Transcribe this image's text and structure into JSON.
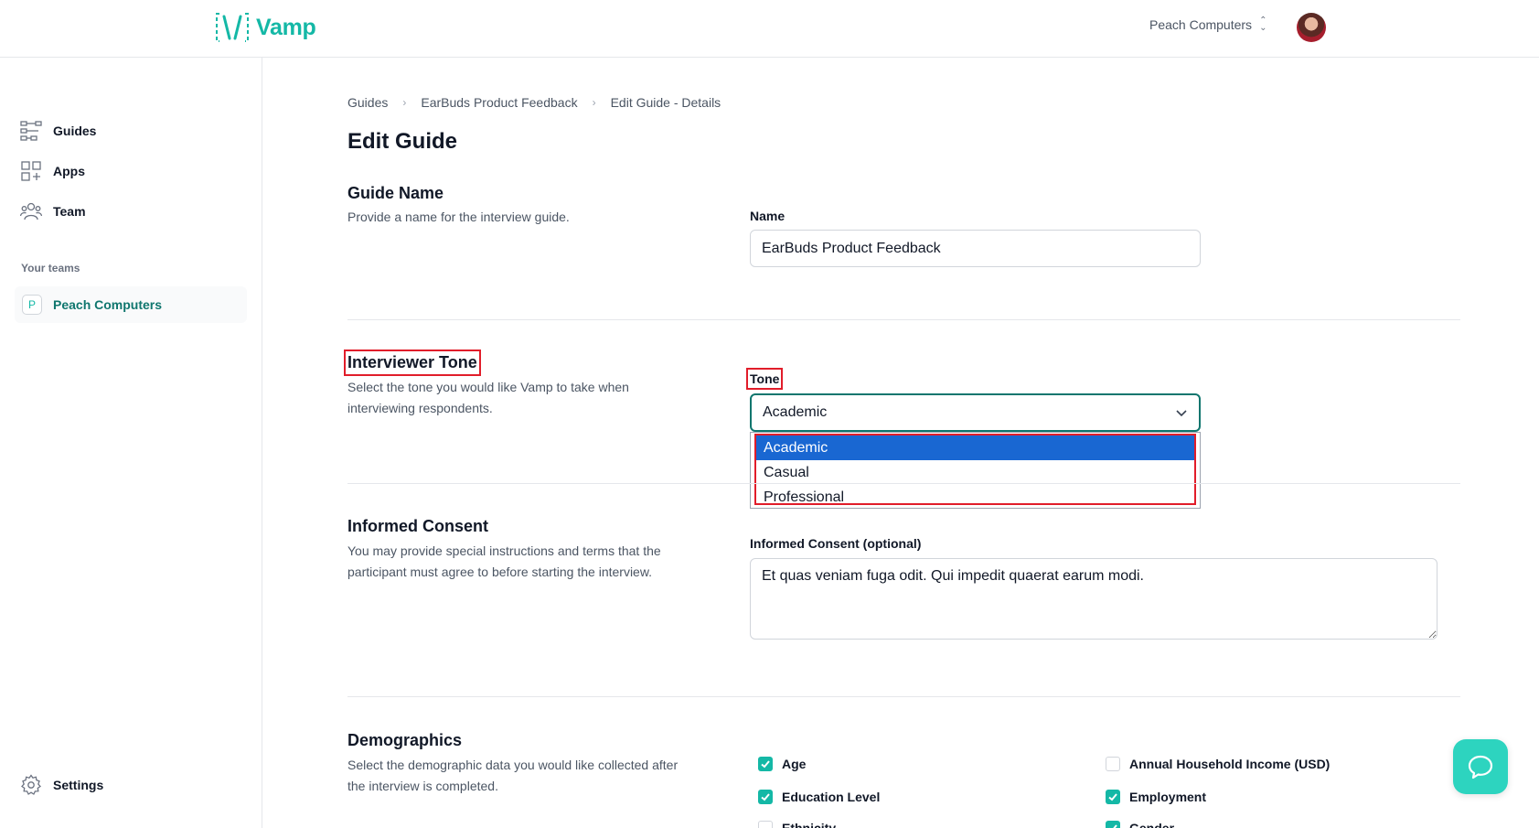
{
  "header": {
    "logo_text": "Vamp",
    "team_switcher": "Peach Computers"
  },
  "sidebar": {
    "items": [
      {
        "label": "Guides",
        "icon": "guides-icon"
      },
      {
        "label": "Apps",
        "icon": "apps-icon"
      },
      {
        "label": "Team",
        "icon": "team-icon"
      }
    ],
    "teams_heading": "Your teams",
    "team": {
      "badge": "P",
      "name": "Peach Computers"
    },
    "settings": "Settings"
  },
  "breadcrumb": [
    "Guides",
    "EarBuds Product Feedback",
    "Edit Guide - Details"
  ],
  "page_title": "Edit Guide",
  "guide_name": {
    "title": "Guide Name",
    "description": "Provide a name for the interview guide.",
    "field_label": "Name",
    "value": "EarBuds Product Feedback"
  },
  "tone": {
    "title": "Interviewer Tone",
    "description": "Select the tone you would like Vamp to take when interviewing respondents.",
    "field_label": "Tone",
    "selected": "Academic",
    "options": [
      "Academic",
      "Casual",
      "Professional"
    ]
  },
  "consent": {
    "title": "Informed Consent",
    "description": "You may provide special instructions and terms that the participant must agree to before starting the interview.",
    "field_label": "Informed Consent (optional)",
    "value": "Et quas veniam fuga odit. Qui impedit quaerat earum modi."
  },
  "demographics": {
    "title": "Demographics",
    "description": "Select the demographic data you would like collected after the interview is completed.",
    "options": [
      {
        "label": "Age",
        "checked": true
      },
      {
        "label": "Annual Household Income (USD)",
        "checked": false
      },
      {
        "label": "Education Level",
        "checked": true
      },
      {
        "label": "Employment",
        "checked": true
      },
      {
        "label": "Ethnicity",
        "checked": false
      },
      {
        "label": "Gender",
        "checked": true
      }
    ]
  },
  "colors": {
    "accent": "#14b8a6",
    "selected_option": "#1967d2",
    "highlight": "#e11d2a"
  }
}
